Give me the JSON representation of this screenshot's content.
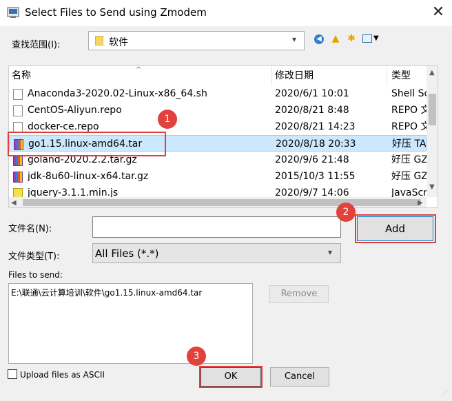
{
  "window": {
    "title": "Select Files to Send using Zmodem",
    "close_glyph": "✕"
  },
  "look_in": {
    "label": "查找范围(I):",
    "value": "软件"
  },
  "toolbar": {
    "icons": [
      "back-icon",
      "up-folder-icon",
      "new-folder-icon",
      "view-menu-icon"
    ]
  },
  "file_list": {
    "columns": [
      "名称",
      "修改日期",
      "类型"
    ],
    "rows": [
      {
        "name": "Anaconda3-2020.02-Linux-x86_64.sh",
        "date": "2020/6/1 10:01",
        "type": "Shell Sc",
        "icon": "script-file-icon"
      },
      {
        "name": "CentOS-Aliyun.repo",
        "date": "2020/8/21 8:48",
        "type": "REPO 文",
        "icon": "file-icon"
      },
      {
        "name": "docker-ce.repo",
        "date": "2020/8/21 14:23",
        "type": "REPO 文",
        "icon": "file-icon"
      },
      {
        "name": "go1.15.linux-amd64.tar",
        "date": "2020/8/18 20:33",
        "type": "好压 TA",
        "icon": "archive-icon",
        "selected": true
      },
      {
        "name": "goland-2020.2.2.tar.gz",
        "date": "2020/9/6 21:48",
        "type": "好压 GZ",
        "icon": "archive-icon"
      },
      {
        "name": "jdk-8u60-linux-x64.tar.gz",
        "date": "2015/10/3 11:55",
        "type": "好压 GZ",
        "icon": "archive-icon"
      },
      {
        "name": "jquery-3.1.1.min.js",
        "date": "2020/9/7 14:06",
        "type": "JavaScr",
        "icon": "js-file-icon"
      }
    ]
  },
  "file_name": {
    "label": "文件名(N):",
    "value": ""
  },
  "file_type": {
    "label": "文件类型(T):",
    "value": "All Files (*.*)"
  },
  "buttons": {
    "add": "Add",
    "remove": "Remove",
    "ok": "OK",
    "cancel": "Cancel"
  },
  "files_to_send": {
    "label": "Files to send:",
    "items": [
      "E:\\联通\\云计算培训\\软件\\go1.15.linux-amd64.tar"
    ]
  },
  "upload_ascii": {
    "label": "Upload files as ASCII",
    "checked": false
  },
  "annotations": {
    "badges": [
      "1",
      "2",
      "3"
    ],
    "color": "#e33c3c"
  }
}
